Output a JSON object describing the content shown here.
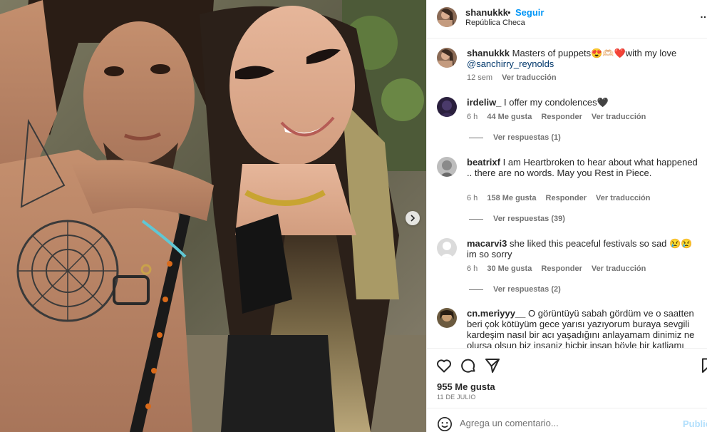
{
  "post": {
    "header": {
      "username": "shanukkk",
      "separator": "•",
      "follow_label": "Seguir",
      "location": "República Checa",
      "more_label": "…"
    },
    "caption": {
      "username": "shanukkk",
      "text": "Masters of puppets😍🫶🏻❤️with my love",
      "mention": "@sanchirry_reynolds",
      "time": "12 sem",
      "translate_label": "Ver traducción"
    },
    "comments": [
      {
        "username": "irdeliw_",
        "text": "I offer my condolences🖤",
        "time": "6 h",
        "likes": "44 Me gusta",
        "reply_label": "Responder",
        "translate_label": "Ver traducción",
        "replies_label": "Ver respuestas (1)"
      },
      {
        "username": "beatrixf",
        "text": "I am Heartbroken to hear about what happened .. there are no words. May you Rest in Piece.",
        "time": "6 h",
        "likes": "158 Me gusta",
        "reply_label": "Responder",
        "translate_label": "Ver traducción",
        "replies_label": "Ver respuestas (39)"
      },
      {
        "username": "macarvi3",
        "text": "she liked this peaceful festivals so sad 😢😢 im so sorry",
        "time": "6 h",
        "likes": "30 Me gusta",
        "reply_label": "Responder",
        "translate_label": "Ver traducción",
        "replies_label": "Ver respuestas (2)"
      },
      {
        "username": "cn.meriyyy__",
        "text": "O görüntüyü sabah gördüm ve o saatten beri çok kötüyüm gece yarısı yazıyorum buraya sevgili kardeşim nasıl bir acı yaşadığını anlayamam dinimiz ne olursa olsun biz insaniz hicbir insan böyle bir katliamı haketmez cok"
      }
    ],
    "likes_total": "955 Me gusta",
    "date": "11 DE JULIO",
    "composer": {
      "placeholder": "Agrega un comentario...",
      "post_label": "Publicar"
    }
  },
  "icons": {
    "like": "heart-outline-icon",
    "comment": "speech-bubble-icon",
    "share": "paper-plane-icon",
    "save": "bookmark-icon",
    "next": "chevron-right-icon",
    "emoji": "smiley-icon"
  },
  "colors": {
    "link_blue": "#0095f6",
    "mention_blue": "#00376b",
    "secondary_text": "#737373",
    "primary_text": "#262626",
    "disabled_blue": "#b2dffc"
  }
}
